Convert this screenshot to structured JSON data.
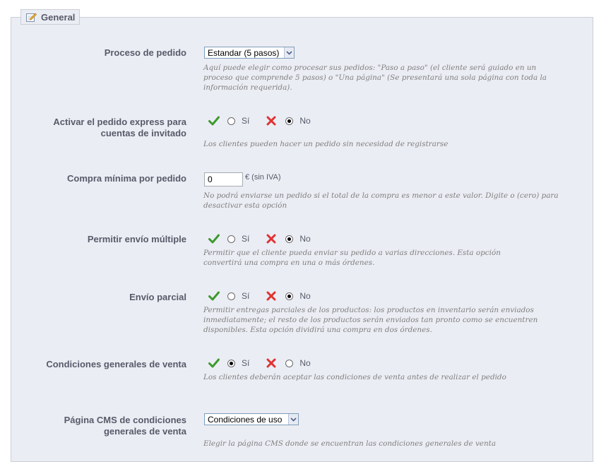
{
  "section": {
    "title": "General",
    "icon": "edit-icon"
  },
  "rows": {
    "order_process": {
      "label": "Proceso de pedido",
      "selected": "Estandar (5 pasos)",
      "hint": "Aquí puede elegir como procesar sus pedidos: \"Paso a paso\" (el cliente será guiado en un proceso que comprende 5 pasos) o \"Una página\" (Se presentará una sola página con toda la información requerida)."
    },
    "express_checkout": {
      "label_line1": "Activar el pedido express para",
      "label_line2": "cuentas de invitado",
      "yes": "Sí",
      "no": "No",
      "value": "no",
      "hint": "Los clientes pueden hacer un pedido sin necesidad de registrarse"
    },
    "minimum_purchase": {
      "label": "Compra mínima por pedido",
      "value": "0",
      "unit": "€ (sin IVA)",
      "hint": "No podrá enviarse un pedido si el total de la compra es menor a este valor. Digite o (cero) para desactivar esta opción"
    },
    "multiple_shipping": {
      "label": "Permitir envío múltiple",
      "yes": "Sí",
      "no": "No",
      "value": "no",
      "hint": "Permitir que el cliente pueda enviar su pedido a varias direcciones. Esta opción convertirá una compra en una o más órdenes."
    },
    "partial_shipping": {
      "label": "Envío parcial",
      "yes": "Sí",
      "no": "No",
      "value": "no",
      "hint": "Permitir entregas parciales de los productos: los productos en inventario serán enviados inmediatamente; el resto de los productos serán enviados tan pronto como se encuentren disponibles. Esta opción dividirá una compra en dos órdenes."
    },
    "terms": {
      "label": "Condiciones generales de venta",
      "yes": "Sí",
      "no": "No",
      "value": "yes",
      "hint": "Los clientes deberán aceptar las condiciones de venta antes de realizar el pedido"
    },
    "cms_page": {
      "label_line1": "Página CMS de condiciones",
      "label_line2": "generales de venta",
      "selected": "Condiciones de uso",
      "hint": "Elegir la página CMS donde se encuentran las condiciones generales de venta"
    }
  },
  "colors": {
    "panel": "#EBEDF4",
    "border": "#CCCED7",
    "label": "#585A69",
    "hint": "#7F7F7F",
    "check": "#3D9A2E",
    "cross": "#E03333"
  }
}
